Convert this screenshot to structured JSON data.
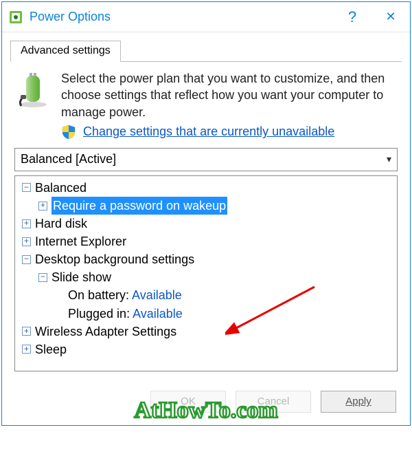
{
  "titlebar": {
    "title": "Power Options",
    "help_label": "?",
    "close_label": "✕"
  },
  "tabs": {
    "advanced": "Advanced settings"
  },
  "intro_text": "Select the power plan that you want to customize, and then choose settings that reflect how you want your computer to manage power.",
  "link_text": "Change settings that are currently unavailable",
  "combo_value": "Balanced [Active]",
  "tree": {
    "balanced": "Balanced",
    "require_password": "Require a password on wakeup",
    "hard_disk": "Hard disk",
    "internet_explorer": "Internet Explorer",
    "desktop_bg": "Desktop background settings",
    "slideshow": "Slide show",
    "on_battery_label": "On battery:",
    "on_battery_value": "Available",
    "plugged_in_label": "Plugged in:",
    "plugged_in_value": "Available",
    "wireless": "Wireless Adapter Settings",
    "sleep": "Sleep"
  },
  "buttons": {
    "ok": "OK",
    "cancel": "Cancel",
    "apply": "Apply"
  },
  "watermark": "AtHowTo.com"
}
